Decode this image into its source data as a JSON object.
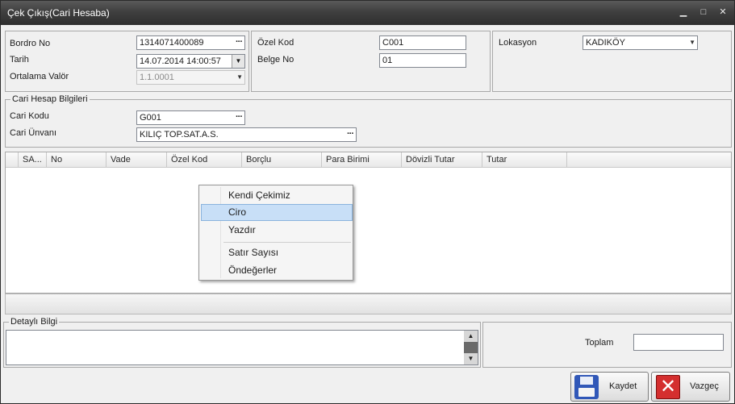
{
  "window": {
    "title": "Çek Çıkış(Cari Hesaba)",
    "controls": {
      "minimize": "▁",
      "maximize": "□",
      "close": "✕"
    }
  },
  "header_left": {
    "bordro_no_label": "Bordro No",
    "bordro_no_value": "1314071400089",
    "tarih_label": "Tarih",
    "tarih_value": "14.07.2014 14:00:57",
    "ortalama_valor_label": "Ortalama Valör",
    "ortalama_valor_value": "1.1.0001"
  },
  "header_mid": {
    "ozel_kod_label": "Özel Kod",
    "ozel_kod_value": "C001",
    "belge_no_label": "Belge No",
    "belge_no_value": "01"
  },
  "header_right": {
    "lokasyon_label": "Lokasyon",
    "lokasyon_value": "KADIKÖY"
  },
  "cari": {
    "group_title": "Cari Hesap Bilgileri",
    "cari_kodu_label": "Cari Kodu",
    "cari_kodu_value": "G001",
    "cari_unvani_label": "Cari Ünvanı",
    "cari_unvani_value": "KILIÇ TOP.SAT.A.S."
  },
  "grid": {
    "columns": [
      "SA...",
      "No",
      "Vade",
      "Özel Kod",
      "Borçlu",
      "Para Birimi",
      "Dövizli Tutar",
      "Tutar"
    ]
  },
  "context_menu": {
    "items": [
      "Kendi Çekimiz",
      "Ciro",
      "Yazdır",
      "Satır Sayısı",
      "Öndeğerler"
    ],
    "highlighted": "Ciro"
  },
  "detail": {
    "group_title": "Detaylı Bilgi",
    "toplam_label": "Toplam",
    "toplam_value": ""
  },
  "buttons": {
    "save_label": "Kaydet",
    "cancel_label": "Vazgeç"
  },
  "colors": {
    "titlebar": "#3f3f3f",
    "menu_highlight": "#c8dff7",
    "save_icon": "#3158b8",
    "cancel_icon": "#d42f2f"
  }
}
